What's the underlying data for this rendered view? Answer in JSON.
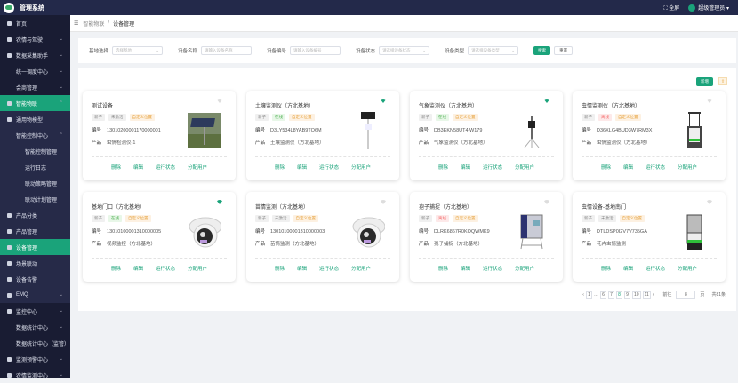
{
  "app": {
    "title": "管理系统",
    "fullscreen": "全屏",
    "user": "超级管理员"
  },
  "sidebar": [
    {
      "label": "首页",
      "chev": false,
      "style": "top"
    },
    {
      "label": "农情与驾驶",
      "chev": true,
      "style": "top"
    },
    {
      "label": "数据采集助手",
      "chev": true,
      "style": "top"
    },
    {
      "label": "统一调度中心",
      "chev": true,
      "style": "top",
      "indent": 1
    },
    {
      "label": "会商管理",
      "chev": true,
      "style": "top",
      "indent": 1
    },
    {
      "label": "智能物联",
      "chev": true,
      "style": "active",
      "up": true
    },
    {
      "label": "通用物模型",
      "style": "sub"
    },
    {
      "label": "智能控制中心",
      "chev": true,
      "style": "sub",
      "indent": 1,
      "up": true
    },
    {
      "label": "智能控制管理",
      "style": "sub",
      "indent": 2
    },
    {
      "label": "运行日志",
      "style": "sub",
      "indent": 2
    },
    {
      "label": "联动策略管理",
      "style": "sub",
      "indent": 2
    },
    {
      "label": "联动计划管理",
      "style": "sub",
      "indent": 2
    },
    {
      "label": "产品分类",
      "style": "sub"
    },
    {
      "label": "产品管理",
      "style": "sub"
    },
    {
      "label": "设备管理",
      "style": "active"
    },
    {
      "label": "场景联动",
      "style": "sub"
    },
    {
      "label": "设备告警",
      "style": "sub"
    },
    {
      "label": "EMQ",
      "chev": true,
      "style": "sub"
    },
    {
      "label": "监控中心",
      "chev": true,
      "style": "top"
    },
    {
      "label": "数据统计中心",
      "chev": true,
      "style": "top",
      "indent": 1
    },
    {
      "label": "数据统计中心（监管）",
      "style": "top",
      "indent": 1
    },
    {
      "label": "监测预警中心",
      "chev": true,
      "style": "top"
    },
    {
      "label": "农情监测中心",
      "chev": true,
      "style": "top"
    }
  ],
  "breadcrumb": {
    "parent": "智能物联",
    "sep": "/",
    "current": "设备管理"
  },
  "filter": {
    "base_label": "基地选择",
    "base_placeholder": "选择基地",
    "name_label": "设备名称",
    "name_placeholder": "请输入设备名称",
    "code_label": "设备编号",
    "code_placeholder": "请输入设备编号",
    "status_label": "设备状态",
    "status_placeholder": "请选择设备状态",
    "type_label": "设备类型",
    "type_placeholder": "请选择设备类型",
    "search": "搜索",
    "reset": "重置"
  },
  "toolbar": {
    "add": "新增",
    "export": "⇪"
  },
  "labels": {
    "code": "编号",
    "product": "产品",
    "delete": "删除",
    "edit": "编辑",
    "run_status": "运行状态",
    "assign_user": "分配用户"
  },
  "colors": {
    "accent": "#1aa37a",
    "sidebar": "#191c33",
    "topbar": "#23294a"
  },
  "cards": [
    {
      "title": "测试设备",
      "tag": "新子",
      "status": "未激活",
      "status_type": "na",
      "loc": "自定义位置",
      "code": "13010200001170000001",
      "product": "虫情检测仪-1",
      "online": false,
      "img": "solar"
    },
    {
      "title": "土壤监测仪（方北基地）",
      "tag": "新子",
      "status": "在线",
      "status_type": "on",
      "loc": "自定义位置",
      "code": "D3LY534L8YAB9TQ6M",
      "product": "土壤监测仪（方北基地）",
      "online": true,
      "img": "pole"
    },
    {
      "title": "气象监测仪（方北基地）",
      "tag": "新子",
      "status": "在线",
      "status_type": "on",
      "loc": "自定义位置",
      "code": "DB3EKN58UT4IW179",
      "product": "气象监测仪（方北基地）",
      "online": true,
      "img": "weather"
    },
    {
      "title": "虫情监测仪（方北基地）",
      "tag": "新子",
      "status": "离线",
      "status_type": "off",
      "loc": "自定义位置",
      "code": "D36XLG4BUD3W7RM3X",
      "product": "虫情监测仪（方北基地）",
      "online": false,
      "img": "insect"
    },
    {
      "title": "基地门口（方北基地）",
      "tag": "新子",
      "status": "在线",
      "status_type": "on",
      "loc": "自定义位置",
      "code": "13010100001310000005",
      "product": "视频监控（方北基地）",
      "online": true,
      "img": "camera"
    },
    {
      "title": "苗情监测（方北基地）",
      "tag": "新子",
      "status": "未激活",
      "status_type": "na",
      "loc": "自定义位置",
      "code": "13010100001310000003",
      "product": "苗情监测（方北基地）",
      "online": false,
      "img": "camera"
    },
    {
      "title": "孢子捕捉（方北基地）",
      "tag": "新子",
      "status": "离线",
      "status_type": "off",
      "loc": "自定义位置",
      "code": "DLRK6867R0KOQWMK9",
      "product": "孢子捕捉（方北基地）",
      "online": false,
      "img": "spore"
    },
    {
      "title": "虫情设备-基地南门",
      "tag": "新子",
      "status": "未激活",
      "status_type": "na",
      "loc": "自定义位置",
      "code": "DTLDSP0I2V7V735GA",
      "product": "花卉虫情监测",
      "online": false,
      "img": "insect2"
    }
  ],
  "pagination": {
    "prev": "‹",
    "next": "›",
    "first": "1",
    "ellipsis": "…",
    "pages": [
      "6",
      "7",
      "8",
      "9",
      "10",
      "11"
    ],
    "current": "8",
    "goto_label": "前往",
    "goto_value": "8",
    "page_unit": "页",
    "total": "共81条"
  }
}
